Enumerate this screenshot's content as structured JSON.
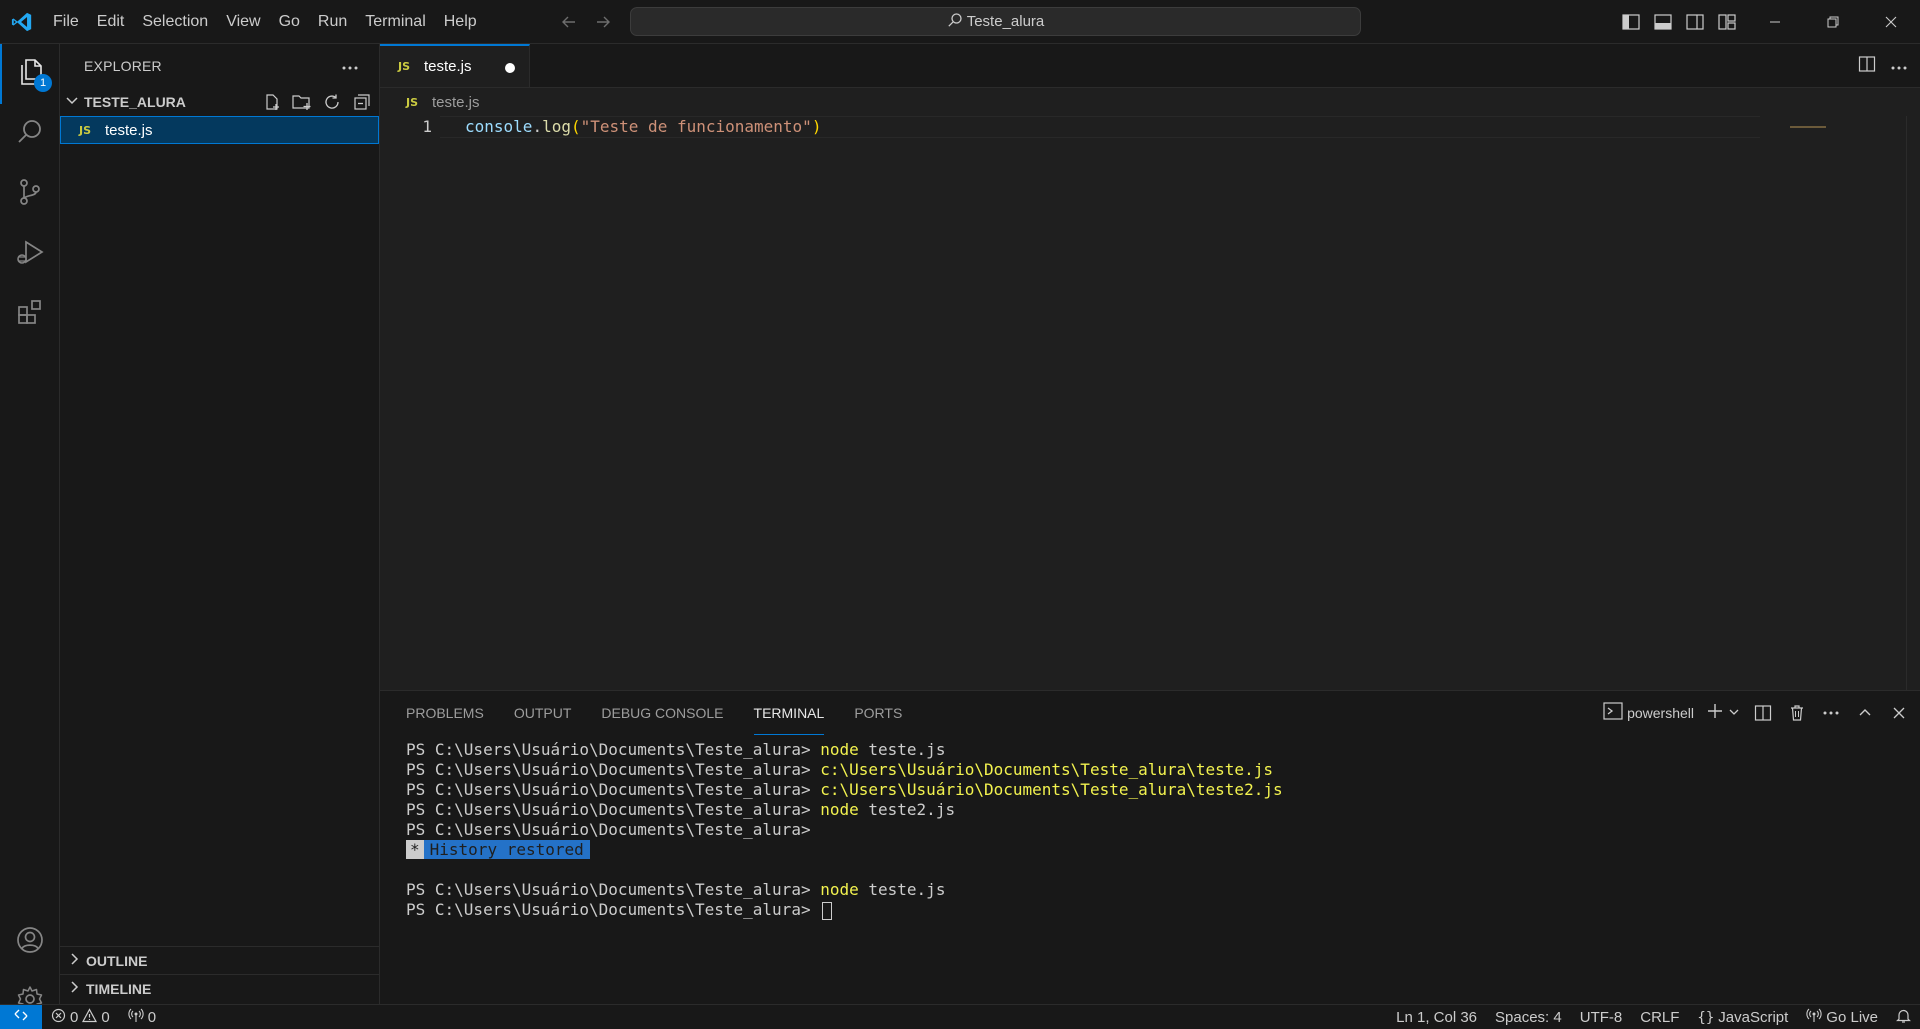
{
  "window": {
    "search_text": "Teste_alura"
  },
  "menu": {
    "items": [
      "File",
      "Edit",
      "Selection",
      "View",
      "Go",
      "Run",
      "Terminal",
      "Help"
    ]
  },
  "activity_bar": {
    "explorer_badge": "1"
  },
  "sidebar": {
    "title": "EXPLORER",
    "folder": "TESTE_ALURA",
    "files": [
      {
        "icon": "JS",
        "name": "teste.js"
      }
    ],
    "sections": [
      "OUTLINE",
      "TIMELINE"
    ]
  },
  "editor": {
    "tab": {
      "icon": "JS",
      "label": "teste.js",
      "dirty": true
    },
    "breadcrumb": {
      "icon": "JS",
      "label": "teste.js"
    },
    "line_number": "1",
    "code": {
      "object": "console",
      "dot": ".",
      "method": "log",
      "open_paren": "(",
      "string": "\"Teste de funcionamento\"",
      "close_paren": ")"
    }
  },
  "panel": {
    "tabs": [
      "PROBLEMS",
      "OUTPUT",
      "DEBUG CONSOLE",
      "TERMINAL",
      "PORTS"
    ],
    "active_tab": "TERMINAL",
    "shell": "powershell",
    "terminal_lines": [
      {
        "prompt": "PS C:\\Users\\Usuário\\Documents\\Teste_alura> ",
        "cmd": "node",
        "arg": " teste.js"
      },
      {
        "prompt": "PS C:\\Users\\Usuário\\Documents\\Teste_alura> ",
        "path": "c:\\Users\\Usuário\\Documents\\Teste_alura\\teste.js"
      },
      {
        "prompt": "PS C:\\Users\\Usuário\\Documents\\Teste_alura> ",
        "path": "c:\\Users\\Usuário\\Documents\\Teste_alura\\teste2.js"
      },
      {
        "prompt": "PS C:\\Users\\Usuário\\Documents\\Teste_alura> ",
        "cmd": "node",
        "arg": " teste2.js"
      },
      {
        "prompt": "PS C:\\Users\\Usuário\\Documents\\Teste_alura>"
      }
    ],
    "history_star": "*",
    "history_text": "History restored",
    "after_lines": [
      {
        "prompt": "PS C:\\Users\\Usuário\\Documents\\Teste_alura> ",
        "cmd": "node",
        "arg": " teste.js"
      },
      {
        "prompt": "PS C:\\Users\\Usuário\\Documents\\Teste_alura> "
      }
    ]
  },
  "status_bar": {
    "errors": "0",
    "warnings": "0",
    "ports": "0",
    "position": "Ln 1, Col 36",
    "spaces": "Spaces: 4",
    "encoding": "UTF-8",
    "eol": "CRLF",
    "language": "JavaScript",
    "go_live": "Go Live"
  },
  "colors": {
    "accent": "#0078d4",
    "js_icon": "#cbcb41",
    "terminal_yellow": "#f2f24f"
  }
}
